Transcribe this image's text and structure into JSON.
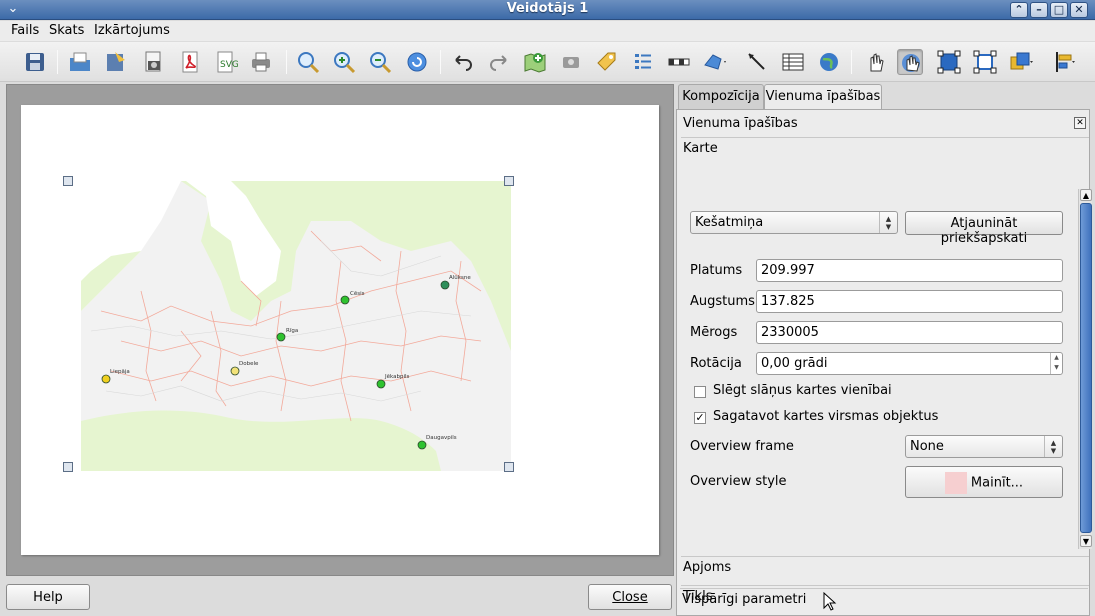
{
  "window": {
    "title": "Veidotājs 1"
  },
  "menubar": {
    "items": [
      "Fails",
      "Skats",
      "Izkārtojums"
    ]
  },
  "colors": {
    "title_bar": "#4a78b3",
    "scroll_thumb": "#4f80c8",
    "overview_swatch": "#f6cfd0",
    "map_land": "#f2f2f2",
    "map_outside": "#e6f5d0",
    "map_boundaries": "#f3a99a"
  },
  "toolbar": {
    "icons": [
      "save-icon",
      "open-template-icon",
      "save-template-icon",
      "export-image-icon",
      "export-pdf-icon",
      "export-svg-icon",
      "print-icon",
      "zoom-full-icon",
      "zoom-in-icon",
      "zoom-out-icon",
      "refresh-icon",
      "undo-icon",
      "redo-icon",
      "add-map-icon",
      "add-image-icon",
      "add-label-icon",
      "add-legend-icon",
      "add-scalebar-icon",
      "add-shape-icon",
      "add-arrow-icon",
      "add-table-icon",
      "add-html-icon",
      "select-move-icon",
      "move-content-icon",
      "group-icon",
      "ungroup-icon",
      "raise-items-icon",
      "align-items-icon"
    ]
  },
  "map": {
    "cities": [
      {
        "name": "Rīga"
      },
      {
        "name": "Cēsis"
      },
      {
        "name": "Alūksne"
      },
      {
        "name": "Dobele"
      },
      {
        "name": "Liepāja"
      },
      {
        "name": "Jēkabpils"
      },
      {
        "name": "Daugavpils"
      }
    ]
  },
  "bottom": {
    "help_label": "Help",
    "close_label": "Close"
  },
  "panel": {
    "tabs": [
      {
        "label": "Kompozīcija",
        "active": false
      },
      {
        "label": "Vienuma īpašības",
        "active": true
      }
    ],
    "header": "Vienuma īpašības",
    "section_title": "Karte",
    "cache_combo": "Kešatmiņa",
    "update_preview_label": "Atjaunināt priekšapskati",
    "fields": {
      "width_label": "Platums",
      "width_value": "209.997",
      "height_label": "Augstums",
      "height_value": "137.825",
      "scale_label": "Mērogs",
      "scale_value": "2330005",
      "rotation_label": "Rotācija",
      "rotation_value": "0,00 grādi"
    },
    "lock_layers_label": "Slēgt slāņus kartes vienībai",
    "lock_layers_checked": false,
    "draw_canvas_label": "Sagatavot kartes virsmas objektus",
    "draw_canvas_checked": true,
    "overview_frame_label": "Overview frame",
    "overview_frame_value": "None",
    "overview_style_label": "Overview style",
    "change_label": "Mainīt...",
    "sections_collapsed": [
      "Apjoms",
      "Tīkls",
      "Vispārīgi parametri"
    ]
  }
}
